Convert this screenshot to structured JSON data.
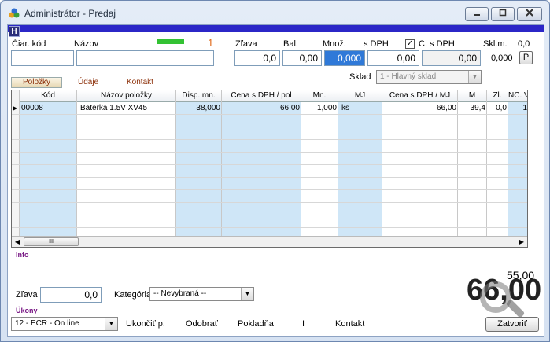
{
  "window": {
    "title": "Administrátor - Predaj"
  },
  "hbadge": "H",
  "form": {
    "barcode_label": "Čiar. kód",
    "name_label": "Názov",
    "count_indicator": "1",
    "discount_label": "Zľava",
    "discount_value": "0,0",
    "pack_label": "Bal.",
    "pack_value": "0,00",
    "qty_label": "Množ.",
    "qty_value": "0,000",
    "with_vat_label": "s DPH",
    "with_vat_value": "0,00",
    "total_vat_checkbox": "✓",
    "total_vat_label": "C. s DPH",
    "total_vat_value": "0,00",
    "stock_label": "Skl.m.",
    "stock_value_top": "0,0",
    "stock_value": "0,000",
    "p_button": "P"
  },
  "tabs": {
    "items": "Položky",
    "data": "Údaje",
    "contact": "Kontakt"
  },
  "warehouse": {
    "label": "Sklad",
    "value": "1 - Hlavný sklad"
  },
  "grid": {
    "headers": [
      "Kód",
      "Názov položky",
      "Disp. mn.",
      "Cena s DPH / pol",
      "Mn.",
      "MJ",
      "Cena s DPH / MJ",
      "M",
      "Zl.",
      "NC. V"
    ],
    "rows": [
      [
        "00008",
        "Baterka 1.5V XV45",
        "38,000",
        "66,00",
        "1,000",
        "ks",
        "66,00",
        "39,4",
        "0,0",
        "1"
      ]
    ],
    "row_marker": "▶",
    "scroll_left": "◀",
    "scroll_right": "▶",
    "scroll_thumb": "III"
  },
  "info_label": "Info",
  "footer": {
    "discount_label": "Zľava",
    "discount_value": "0,0",
    "category_label": "Kategória",
    "category_value": "-- Nevybraná --",
    "total_small": "55,00",
    "total_big": "66,00",
    "actions_label": "Úkony",
    "register_value": "12 - ECR - On line",
    "end_label": "Ukončiť p.",
    "remove_label": "Odobrať",
    "cashbox_label": "Pokladňa",
    "separator": "I",
    "contact_label": "Kontakt",
    "close_label": "Zatvoriť"
  }
}
